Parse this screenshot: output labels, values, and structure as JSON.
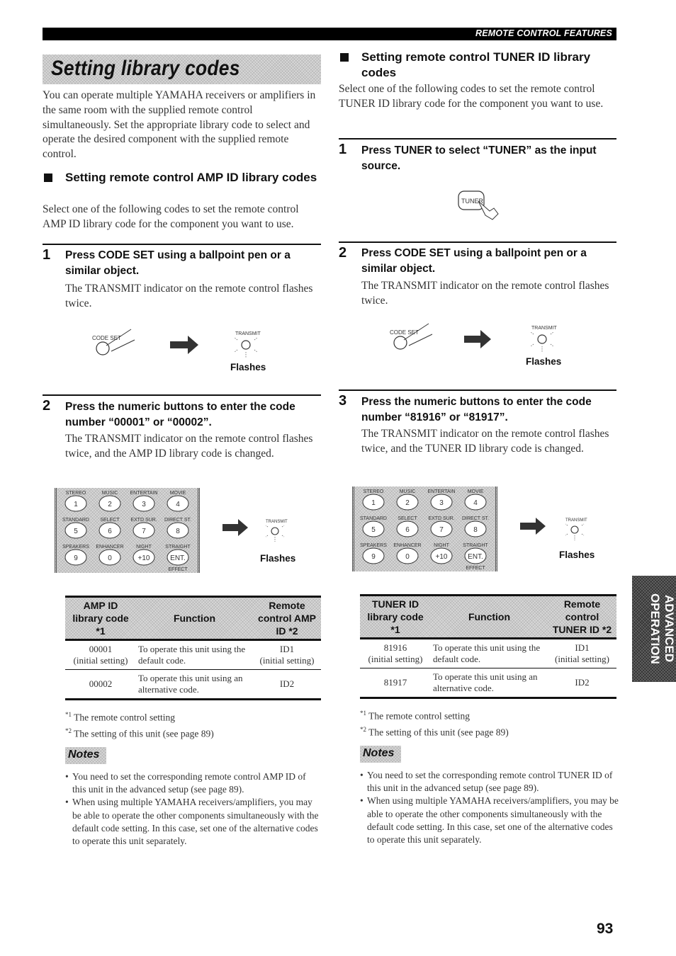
{
  "header": {
    "section_label": "REMOTE CONTROL FEATURES"
  },
  "page_title": "Setting library codes",
  "intro": "You can operate multiple YAMAHA receivers or amplifiers in the same room with the supplied remote control simultaneously. Set the appropriate library code to select and operate the desired component with the supplied remote control.",
  "amp": {
    "heading": "Setting remote control AMP ID library codes",
    "description": "Select one of the following codes to set the remote control AMP ID library code for the component you want to use.",
    "steps": [
      {
        "num": "1",
        "title": "Press CODE SET using a ballpoint pen or a similar object.",
        "text": "The TRANSMIT indicator on the remote control flashes twice.",
        "caption": "Flashes"
      },
      {
        "num": "2",
        "title": "Press the numeric buttons to enter the code number “00001” or “00002”.",
        "text": "The TRANSMIT indicator on the remote control flashes twice, and the AMP ID library code is changed.",
        "caption": "Flashes"
      }
    ],
    "table": {
      "headers": [
        "AMP ID library code *1",
        "Function",
        "Remote control AMP ID *2"
      ],
      "rows": [
        {
          "code": "00001",
          "code_note": "(initial setting)",
          "function": "To operate this unit using the default code.",
          "id": "ID1",
          "id_note": "(initial setting)"
        },
        {
          "code": "00002",
          "code_note": "",
          "function": "To operate this unit using an alternative code.",
          "id": "ID2",
          "id_note": ""
        }
      ]
    },
    "footnotes": [
      {
        "mark": "*1",
        "text": "The remote control setting"
      },
      {
        "mark": "*2",
        "text": "The setting of this unit (see page 89)"
      }
    ],
    "notes_label": "Notes",
    "notes": [
      "You need to set the corresponding remote control AMP ID of this unit in the advanced setup (see page 89).",
      "When using multiple YAMAHA receivers/amplifiers, you may be able to operate the other components simultaneously with the default code setting. In this case, set one of the alternative codes to operate this unit separately."
    ]
  },
  "tuner": {
    "heading": "Setting remote control TUNER ID library codes",
    "description": "Select one of the following codes to set the remote control TUNER ID library code for the component you want to use.",
    "steps": [
      {
        "num": "1",
        "title": "Press TUNER to select “TUNER” as the input source.",
        "text": "",
        "caption": ""
      },
      {
        "num": "2",
        "title": "Press CODE SET using a ballpoint pen or a similar object.",
        "text": "The TRANSMIT indicator on the remote control flashes twice.",
        "caption": "Flashes"
      },
      {
        "num": "3",
        "title": "Press the numeric buttons to enter the code number “81916” or “81917”.",
        "text": "The TRANSMIT indicator on the remote control flashes twice, and the TUNER ID library code is changed.",
        "caption": "Flashes"
      }
    ],
    "table": {
      "headers": [
        "TUNER ID library code *1",
        "Function",
        "Remote control TUNER ID *2"
      ],
      "rows": [
        {
          "code": "81916",
          "code_note": "(initial setting)",
          "function": "To operate this unit using the default code.",
          "id": "ID1",
          "id_note": "(initial setting)"
        },
        {
          "code": "81917",
          "code_note": "",
          "function": "To operate this unit using an alternative code.",
          "id": "ID2",
          "id_note": ""
        }
      ]
    },
    "footnotes": [
      {
        "mark": "*1",
        "text": "The remote control setting"
      },
      {
        "mark": "*2",
        "text": "The setting of this unit (see page 89)"
      }
    ],
    "notes_label": "Notes",
    "notes": [
      "You need to set the corresponding remote control TUNER ID of this unit in the advanced setup (see page 89).",
      "When using multiple YAMAHA receivers/amplifiers, you may be able to operate the other components simultaneously with the default code setting. In this case, set one of the alternative codes to operate this unit separately."
    ]
  },
  "illustrations": {
    "code_set_label": "CODE SET",
    "transmit_label": "TRANSMIT",
    "tuner_button_label": "TUNER",
    "keypad": {
      "rows": [
        {
          "labels": [
            "STEREO",
            "MUSIC",
            "ENTERTAIN",
            "MOVIE"
          ],
          "keys": [
            "1",
            "2",
            "3",
            "4"
          ]
        },
        {
          "labels": [
            "STANDARD",
            "SELECT",
            "EXTD SUR.",
            "DIRECT ST."
          ],
          "keys": [
            "5",
            "6",
            "7",
            "8"
          ]
        },
        {
          "labels": [
            "SPEAKERS",
            "ENHANCER",
            "NIGHT",
            "STRAIGHT"
          ],
          "keys": [
            "9",
            "0",
            "+10",
            "ENT."
          ]
        }
      ],
      "bottom_label": "EFFECT"
    }
  },
  "side_tab": "ADVANCED OPERATION",
  "page_number": "93"
}
